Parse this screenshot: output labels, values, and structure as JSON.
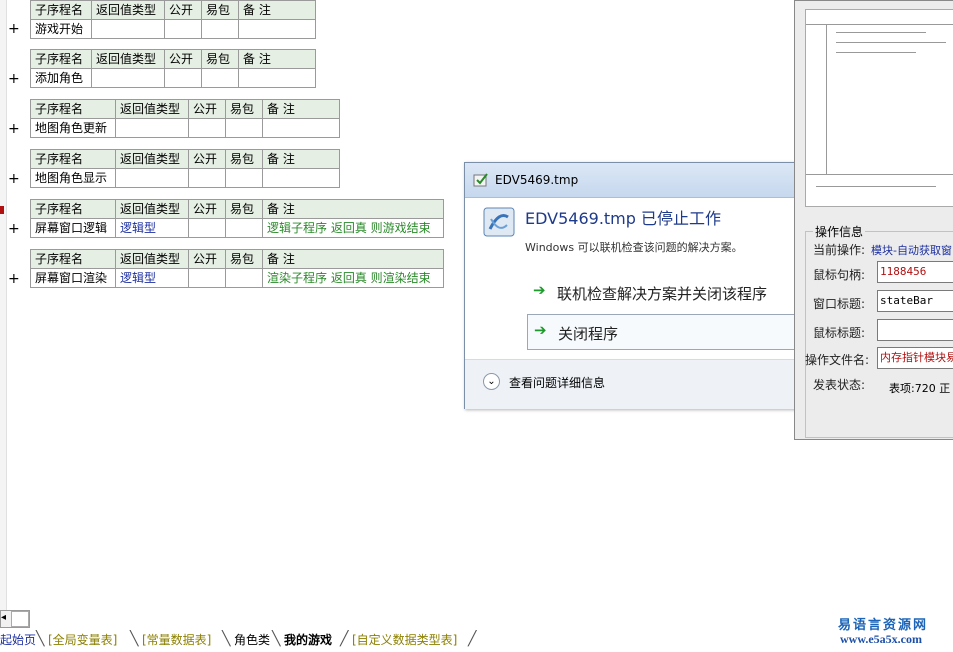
{
  "header_labels": {
    "name": "子序程名",
    "rettype": "返回值类型",
    "public": "公开",
    "easy": "易包",
    "note": "备 注"
  },
  "subs": [
    {
      "name": "游戏开始",
      "rettype": "",
      "note": ""
    },
    {
      "name": "添加角色",
      "rettype": "",
      "note": ""
    },
    {
      "name": "地图角色更新",
      "rettype": "",
      "note": ""
    },
    {
      "name": "地图角色显示",
      "rettype": "",
      "note": ""
    },
    {
      "name": "屏幕窗口逻辑",
      "rettype": "逻辑型",
      "note": "逻辑子程序   返回真 则游戏结束"
    },
    {
      "name": "屏幕窗口渲染",
      "rettype": "逻辑型",
      "note": "渲染子程序   返回真 则渲染结束"
    }
  ],
  "expand_symbol": "+",
  "dialog": {
    "title": "EDV5469.tmp",
    "heading": "EDV5469.tmp 已停止工作",
    "subtext": "Windows 可以联机检查该问题的解决方案。",
    "option1": "联机检查解决方案并关闭该程序",
    "option2": "关闭程序",
    "details": "查看问题详细信息"
  },
  "right_panel": {
    "group_title": "操作信息",
    "current_op_label": "当前操作:",
    "current_op_value": "模块-自动获取窗",
    "handle_label": "鼠标句柄:",
    "handle_value": "1188456",
    "window_title_label": "窗口标题:",
    "window_title_value": "stateBar",
    "mouse_title_label": "鼠标标题:",
    "mouse_title_value": "",
    "op_file_label": "操作文件名:",
    "op_file_value": "内存指针模块易",
    "publish_label": "发表状态:",
    "publish_value": "表项:720 正"
  },
  "tabs": [
    "起始页",
    "[全局变量表]",
    "[常量数据表]",
    "角色类",
    "我的游戏",
    "[自定义数据类型表]"
  ],
  "watermark": {
    "line1": "易语言资源网",
    "line2": "www.e5a5x.com"
  },
  "colors": {
    "header_bg": "#e6efe4",
    "type_blue": "#1c2fa0",
    "note_green": "#2a8a2a",
    "tab_olive": "#8b7f00"
  }
}
